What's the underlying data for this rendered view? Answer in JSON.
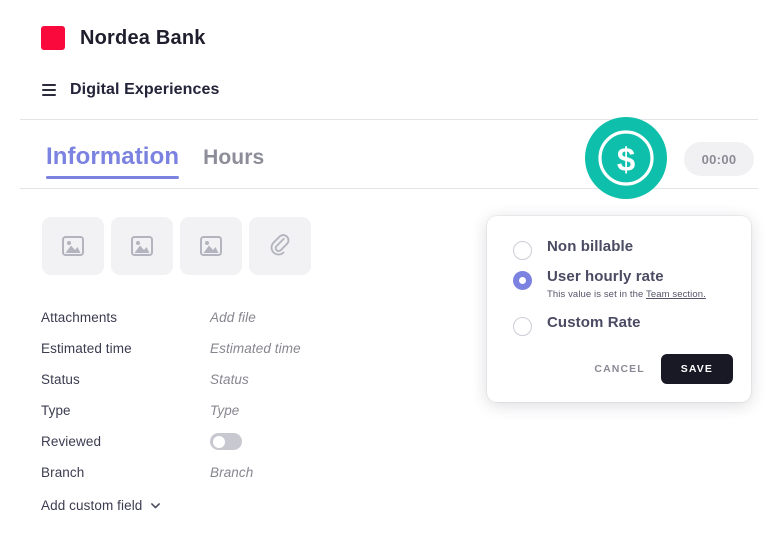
{
  "brand": {
    "logo_icon": "brand-square-icon",
    "name": "Nordea Bank",
    "logo_color": "#fa0a3c"
  },
  "project": {
    "menu_icon": "hamburger-icon",
    "name": "Digital Experiences"
  },
  "tabs": [
    {
      "label": "Information",
      "active": true
    },
    {
      "label": "Hours",
      "active": false
    }
  ],
  "billable": {
    "icon": "dollar-coin-icon",
    "color": "#0ec0ab"
  },
  "timer": {
    "value": "00:00"
  },
  "attachments_strip": [
    {
      "icon": "image-placeholder-icon"
    },
    {
      "icon": "image-placeholder-icon"
    },
    {
      "icon": "image-placeholder-icon"
    },
    {
      "icon": "paperclip-icon"
    }
  ],
  "fields": [
    {
      "label": "Attachments",
      "value": "Add file",
      "type": "text"
    },
    {
      "label": "Estimated time",
      "value": "Estimated time",
      "type": "text"
    },
    {
      "label": "Status",
      "value": "Status",
      "type": "text"
    },
    {
      "label": "Type",
      "value": "Type",
      "type": "text"
    },
    {
      "label": "Reviewed",
      "value": "",
      "type": "toggle",
      "checked": false
    },
    {
      "label": "Branch",
      "value": "Branch",
      "type": "text"
    }
  ],
  "add_custom_field": {
    "label": "Add custom field",
    "icon": "chevron-down-icon"
  },
  "rate_card": {
    "options": [
      {
        "label": "Non billable",
        "selected": false,
        "hint": ""
      },
      {
        "label": "User hourly rate",
        "selected": true,
        "hint_prefix": "This value is set in the ",
        "hint_link": "Team section."
      },
      {
        "label": "Custom Rate",
        "selected": false,
        "hint": ""
      }
    ],
    "cancel_label": "CANCEL",
    "save_label": "SAVE",
    "accent_color": "#7b82e0"
  }
}
